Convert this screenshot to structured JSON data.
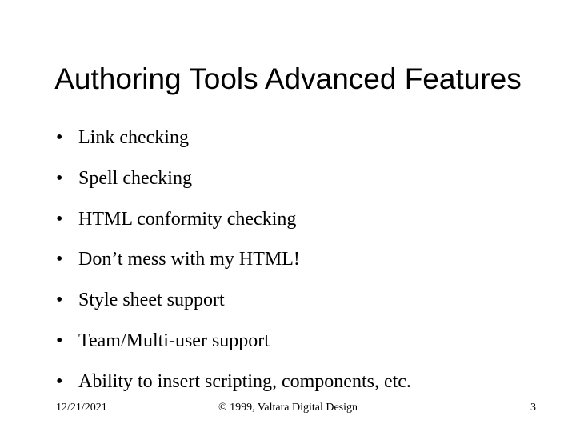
{
  "slide": {
    "title": "Authoring Tools Advanced Features",
    "bullets": [
      "Link checking",
      "Spell checking",
      "HTML conformity checking",
      "Don’t mess with my HTML!",
      "Style sheet support",
      "Team/Multi-user support",
      "Ability to insert scripting, components, etc."
    ],
    "footer": {
      "date": "12/21/2021",
      "copyright": "© 1999, Valtara Digital Design",
      "page": "3"
    }
  }
}
